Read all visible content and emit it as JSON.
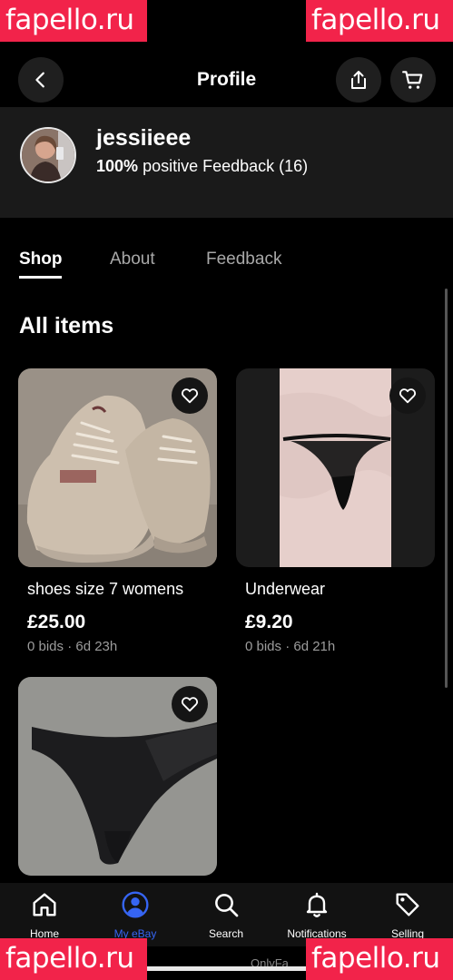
{
  "watermark": "fapello.ru",
  "header": {
    "title": "Profile"
  },
  "seller": {
    "username": "jessiieee",
    "feedback_percent": "100%",
    "feedback_text": "positive Feedback (16)"
  },
  "tabs": [
    {
      "label": "Shop",
      "active": true
    },
    {
      "label": "About",
      "active": false
    },
    {
      "label": "Feedback",
      "active": false
    }
  ],
  "section_title": "All items",
  "items": [
    {
      "title": "shoes size 7 womens",
      "price": "£25.00",
      "meta": "0 bids · 6d 23h",
      "image": "beige-chunky-sneakers"
    },
    {
      "title": "Underwear",
      "price": "£9.20",
      "meta": "0 bids · 6d 21h",
      "image": "black-thong-on-pink-fabric"
    },
    {
      "title": "",
      "price": "",
      "meta": "",
      "image": "black-victoria-thong-on-carpet"
    }
  ],
  "nav": [
    {
      "label": "Home",
      "icon": "home-icon",
      "active": false
    },
    {
      "label": "My eBay",
      "icon": "user-icon",
      "active": true
    },
    {
      "label": "Search",
      "icon": "search-icon",
      "active": false
    },
    {
      "label": "Notifications",
      "icon": "bell-icon",
      "active": false
    },
    {
      "label": "Selling",
      "icon": "tag-icon",
      "active": false
    }
  ],
  "footer_text": "OnlyFa",
  "colors": {
    "accent": "#3665f3",
    "watermark_bg": "#f2234a",
    "card_bg": "#1a1a1a"
  }
}
